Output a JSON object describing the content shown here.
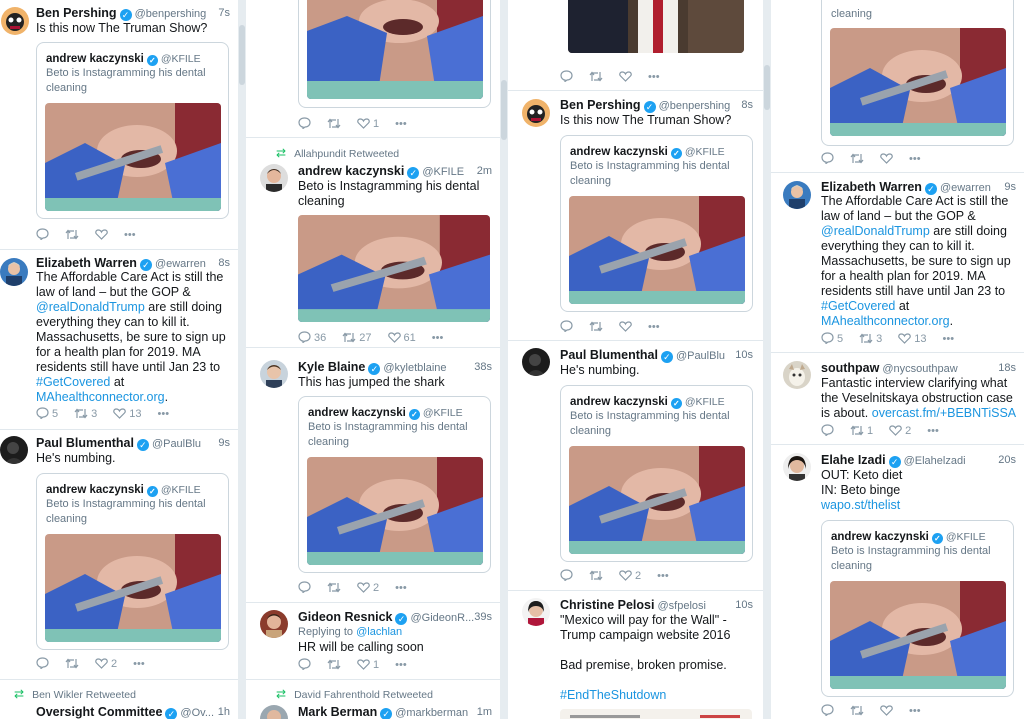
{
  "columns": [
    {
      "tweets": [
        {
          "name": "Ben Pershing",
          "handle": "@benpershing",
          "time": "7s",
          "text": "Is this now The Truman Show?",
          "quote": {
            "name": "andrew kaczynski",
            "handle": "@KFILE",
            "text": "Beto is Instagramming his dental cleaning"
          }
        },
        {
          "name": "Elizabeth Warren",
          "handle": "@ewarren",
          "time": "8s",
          "text_1": "The Affordable Care Act is still the law of land – but the GOP &",
          "link_1": "@realDonaldTrump",
          "text_2": "are still doing everything they can to kill it. Massachusetts, be sure to sign up for a health plan for 2019. MA residents still have until Jan 23 to",
          "link_2": "#GetCovered",
          "text_3": "at",
          "link_3": "MAhealthconnector.org",
          "text_4": ".",
          "replies": "5",
          "retweets": "3",
          "likes": "13"
        },
        {
          "name": "Paul Blumenthal",
          "handle": "@PaulBlu",
          "time": "9s",
          "text": "He's numbing.",
          "quote": {
            "name": "andrew kaczynski",
            "handle": "@KFILE",
            "text": "Beto is Instagramming his dental cleaning"
          },
          "likes": "2"
        },
        {
          "retweeted_by": "Ben Wikler Retweeted",
          "name": "Oversight Committee",
          "handle": "@Ov...",
          "time": "1h"
        }
      ]
    },
    {
      "tweets": [
        {
          "likes": "1"
        },
        {
          "retweeted_by": "Allahpundit Retweeted",
          "name": "andrew kaczynski",
          "handle": "@KFILE",
          "time": "2m",
          "text": "Beto is Instagramming his dental cleaning",
          "replies": "36",
          "retweets": "27",
          "likes": "61"
        },
        {
          "name": "Kyle Blaine",
          "handle": "@kyletblaine",
          "time": "38s",
          "text": "This has jumped the shark",
          "quote": {
            "name": "andrew kaczynski",
            "handle": "@KFILE",
            "text": "Beto is Instagramming his dental cleaning"
          },
          "likes": "2"
        },
        {
          "name": "Gideon Resnick",
          "handle": "@GideonR...",
          "time": "39s",
          "replying_label": "Replying to",
          "replying_to": "@lachlan",
          "text": "HR will be calling soon",
          "likes": "1"
        },
        {
          "retweeted_by": "David Fahrenthold Retweeted",
          "name": "Mark Berman",
          "handle": "@markberman",
          "time": "1m"
        }
      ]
    },
    {
      "tweets": [
        {},
        {
          "name": "Ben Pershing",
          "handle": "@benpershing",
          "time": "8s",
          "text": "Is this now The Truman Show?",
          "quote": {
            "name": "andrew kaczynski",
            "handle": "@KFILE",
            "text": "Beto is Instagramming his dental cleaning"
          }
        },
        {
          "name": "Paul Blumenthal",
          "handle": "@PaulBlu",
          "time": "10s",
          "text": "He's numbing.",
          "quote": {
            "name": "andrew kaczynski",
            "handle": "@KFILE",
            "text": "Beto is Instagramming his dental cleaning"
          },
          "likes": "2"
        },
        {
          "name": "Christine Pelosi",
          "handle": "@sfpelosi",
          "time": "10s",
          "text_1": "\"Mexico will pay for the Wall\" - Trump campaign website 2016",
          "text_2": "Bad premise, broken promise.",
          "hashtag": "#EndTheShutdown"
        }
      ]
    },
    {
      "tweets": [
        {
          "quote_tail": "cleaning"
        },
        {
          "name": "Elizabeth Warren",
          "handle": "@ewarren",
          "time": "9s",
          "text_1": "The Affordable Care Act is still the law of land – but the GOP &",
          "link_1": "@realDonaldTrump",
          "text_2": "are still doing everything they can to kill it. Massachusetts, be sure to sign up for a health plan for 2019. MA residents still have until Jan 23 to",
          "link_2": "#GetCovered",
          "text_3": "at",
          "link_3": "MAhealthconnector.org",
          "text_4": ".",
          "replies": "5",
          "retweets": "3",
          "likes": "13"
        },
        {
          "name": "southpaw",
          "handle": "@nycsouthpaw",
          "time": "18s",
          "text": "Fantastic interview clarifying what the Veselnitskaya obstruction case is about.",
          "link": "overcast.fm/+BEBNTiSSA",
          "replies": "",
          "retweets": "1",
          "likes": "2"
        },
        {
          "name": "Elahe Izadi",
          "handle": "@Elahelzadi",
          "time": "20s",
          "text_1": "OUT: Keto diet",
          "text_2": "IN: Beto binge",
          "link": "wapo.st/thelist",
          "quote": {
            "name": "andrew kaczynski",
            "handle": "@KFILE",
            "text": "Beto is Instagramming his dental cleaning"
          }
        }
      ]
    }
  ],
  "colors": {
    "link": "#1b95e0",
    "verified": "#1da1f2",
    "retweet_green": "#17bf63",
    "muted": "#657786",
    "divider": "#e6ecf0"
  }
}
